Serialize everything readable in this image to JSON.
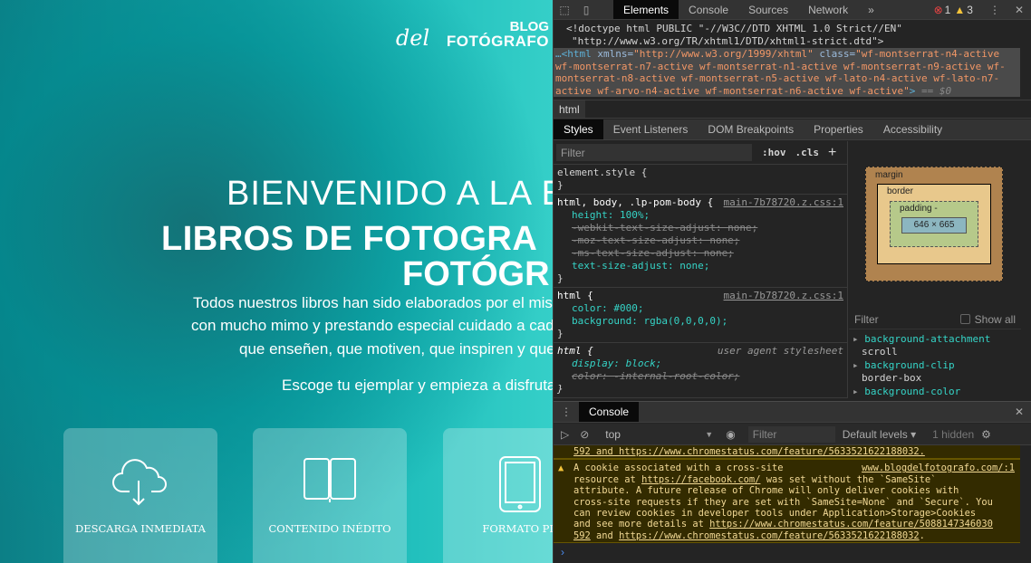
{
  "page": {
    "logo": {
      "script": "del",
      "line1": "BLOG",
      "line2": "FOTÓGRAFO"
    },
    "welcome": "BIENVENIDO A LA B",
    "title_line1": "LIBROS DE FOTOGRA",
    "title_line2": "FOTÓGR",
    "intro": [
      "Todos nuestros libros han sido elaborados por el mis",
      "con mucho mimo y prestando especial cuidado a cad",
      "que enseñen, que motiven, que inspiren y que"
    ],
    "cta": "Escoge tu ejemplar y empieza a disfruta",
    "features": [
      {
        "icon": "cloud-download-icon",
        "label": "DESCARGA INMEDIATA"
      },
      {
        "icon": "open-book-icon",
        "label": "CONTENIDO INÉDITO"
      },
      {
        "icon": "tablet-icon",
        "label": "FORMATO PD"
      }
    ]
  },
  "devtools": {
    "tabs": [
      "Elements",
      "Console",
      "Sources",
      "Network",
      "»"
    ],
    "errors": "1",
    "warnings": "3",
    "dom": {
      "doctype1": "<!doctype html PUBLIC \"-//W3C//DTD XHTML 1.0 Strict//EN\"",
      "doctype2": "\"http://www.w3.org/TR/xhtml1/DTD/xhtml1-strict.dtd\">",
      "html_open": "…<html ",
      "xmlns_attr": "xmlns=",
      "xmlns_val": "\"http://www.w3.org/1999/xhtml\"",
      "class_attr": " class=",
      "class_val": "\"wf-montserrat-n4-active wf-montserrat-n7-active wf-montserrat-n1-active wf-montserrat-n9-active wf-montserrat-n8-active wf-montserrat-n5-active wf-lato-n4-active wf-lato-n7-active wf-arvo-n4-active wf-montserrat-n6-active wf-active\"",
      "close": ">",
      "eq": " == $0"
    },
    "breadcrumb": "html",
    "subtabs": [
      "Styles",
      "Event Listeners",
      "DOM Breakpoints",
      "Properties",
      "Accessibility"
    ],
    "filter_placeholder": "Filter",
    "hov": ":hov",
    "cls": ".cls",
    "rules": {
      "r0": {
        "sel": "element.style {",
        "end": "}"
      },
      "r1": {
        "sel": "html, body, .lp-pom-body {",
        "src": "main-7b78720.z.css:1",
        "p1": "height: 100%;",
        "p2": "-webkit-text-size-adjust: none;",
        "p3": "-moz-text-size-adjust: none;",
        "p4": "-ms-text-size-adjust: none;",
        "p5": "text-size-adjust: none;",
        "end": "}"
      },
      "r2": {
        "sel": "html {",
        "src": "main-7b78720.z.css:1",
        "p1": "color: #000;",
        "p2": "background: rgba(0,0,0,0);",
        "end": "}"
      },
      "r3": {
        "sel": "html {",
        "src": "user agent stylesheet",
        "p1": "display: block;",
        "p2": "color: -internal-root-color;",
        "end": "}"
      }
    },
    "boxmodel": {
      "margin": "margin",
      "border": "border",
      "padding": "padding -",
      "content": "646 × 665",
      "dash": "-"
    },
    "computed": {
      "filter": "Filter",
      "show_all": "Show all",
      "items": [
        {
          "name": "background-attachment",
          "value": "scroll"
        },
        {
          "name": "background-clip",
          "value": "border-box"
        },
        {
          "name": "background-color",
          "value": ""
        }
      ]
    },
    "console": {
      "tab": "Console",
      "context": "top",
      "filter": "Filter",
      "levels": "Default levels ▾",
      "hidden": "1 hidden",
      "prev_tail": "592 and https://www.chromestatus.com/feature/5633521622188032.",
      "warning": {
        "source": "www.blogdelfotografo.com/:1",
        "l1": "A cookie associated with a cross-site",
        "l2a": "resource at ",
        "l2link": "https://facebook.com/",
        "l2b": " was set without the `SameSite`",
        "l3": "attribute. A future release of Chrome will only deliver cookies with",
        "l4": "cross-site requests if they are set with `SameSite=None` and `Secure`. You",
        "l5": "can review cookies in developer tools under Application>Storage>Cookies",
        "l6a": "and see more details at ",
        "l6link": "https://www.chromestatus.com/feature/5088147346030",
        "l7link1": "592",
        "l7b": " and ",
        "l7link2": "https://www.chromestatus.com/feature/5633521622188032",
        "l7c": "."
      }
    }
  }
}
